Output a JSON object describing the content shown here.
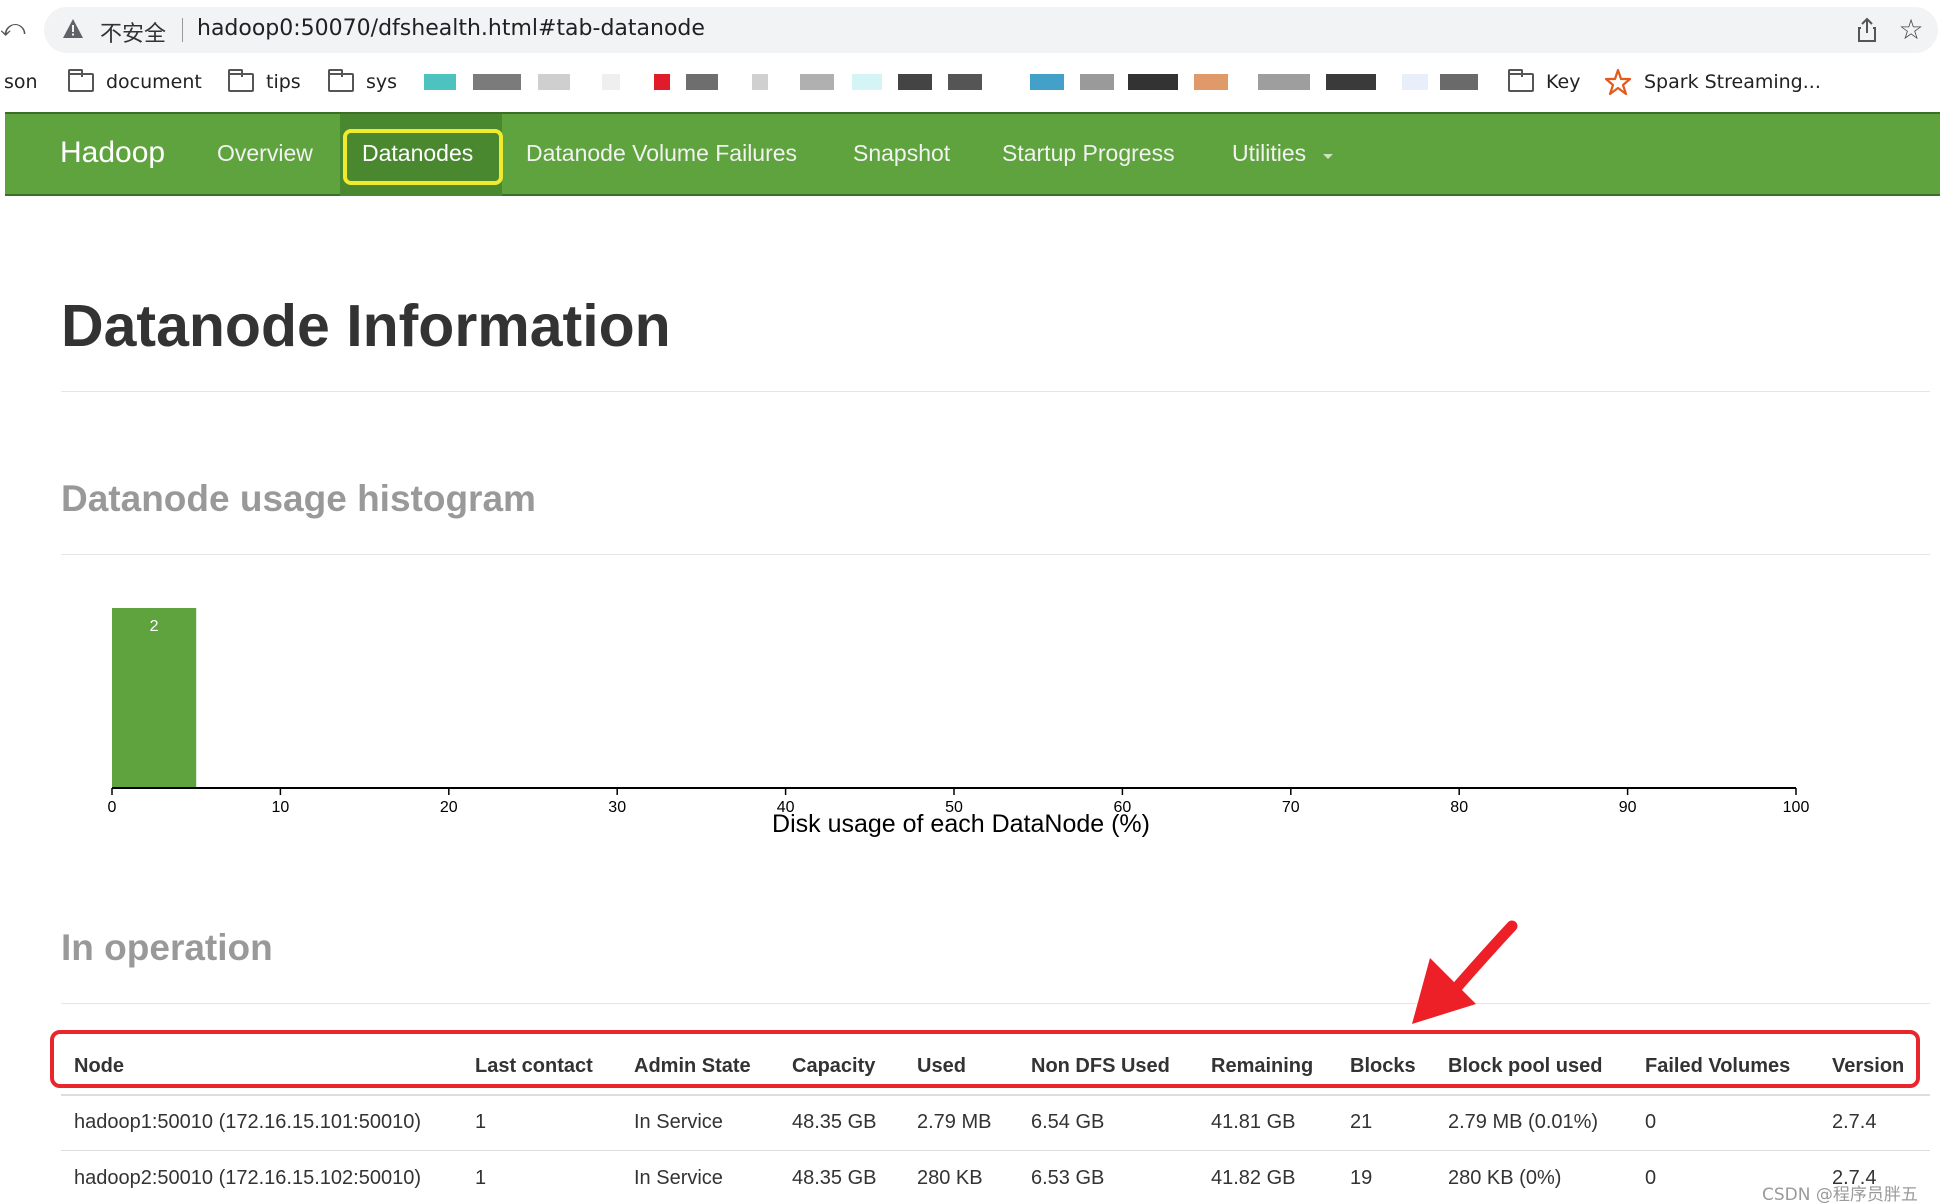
{
  "browser": {
    "security_label": "不安全",
    "url": "hadoop0:50070/dfshealth.html#tab-datanode"
  },
  "bookmarks": [
    {
      "label": "son",
      "type": "text"
    },
    {
      "label": "document",
      "type": "folder"
    },
    {
      "label": "tips",
      "type": "folder"
    },
    {
      "label": "sys",
      "type": "folder"
    },
    {
      "label": "Key",
      "type": "folder"
    },
    {
      "label": "Spark Streaming...",
      "type": "link"
    }
  ],
  "nav": {
    "brand": "Hadoop",
    "items": [
      {
        "label": "Overview"
      },
      {
        "label": "Datanodes",
        "active": true
      },
      {
        "label": "Datanode Volume Failures"
      },
      {
        "label": "Snapshot"
      },
      {
        "label": "Startup Progress"
      },
      {
        "label": "Utilities",
        "has_dropdown": true
      }
    ],
    "color": "#5fa33e"
  },
  "page": {
    "title": "Datanode Information",
    "histogram_title": "Datanode usage histogram",
    "operation_title": "In operation"
  },
  "chart_data": {
    "type": "bar",
    "title": "",
    "xlabel": "Disk usage of each DataNode (%)",
    "ylabel": "",
    "xlim": [
      0,
      100
    ],
    "x_ticks": [
      0,
      10,
      20,
      30,
      40,
      50,
      60,
      70,
      80,
      90,
      100
    ],
    "bins": [
      {
        "x0": 0,
        "x1": 5,
        "count": 2
      }
    ],
    "bar_color": "#5fa33e",
    "grid": false
  },
  "table": {
    "columns": [
      "Node",
      "Last contact",
      "Admin State",
      "Capacity",
      "Used",
      "Non DFS Used",
      "Remaining",
      "Blocks",
      "Block pool used",
      "Failed Volumes",
      "Version"
    ],
    "rows": [
      [
        "hadoop1:50010 (172.16.15.101:50010)",
        "1",
        "In Service",
        "48.35 GB",
        "2.79 MB",
        "6.54 GB",
        "41.81 GB",
        "21",
        "2.79 MB (0.01%)",
        "0",
        "2.7.4"
      ],
      [
        "hadoop2:50010 (172.16.15.102:50010)",
        "1",
        "In Service",
        "48.35 GB",
        "280 KB",
        "6.53 GB",
        "41.82 GB",
        "19",
        "280 KB (0%)",
        "0",
        "2.7.4"
      ]
    ]
  },
  "annotations": {
    "highlight_color": "#e8262b",
    "nav_highlight_color": "#f2ea2c"
  },
  "watermark": "CSDN @程序员胖五"
}
